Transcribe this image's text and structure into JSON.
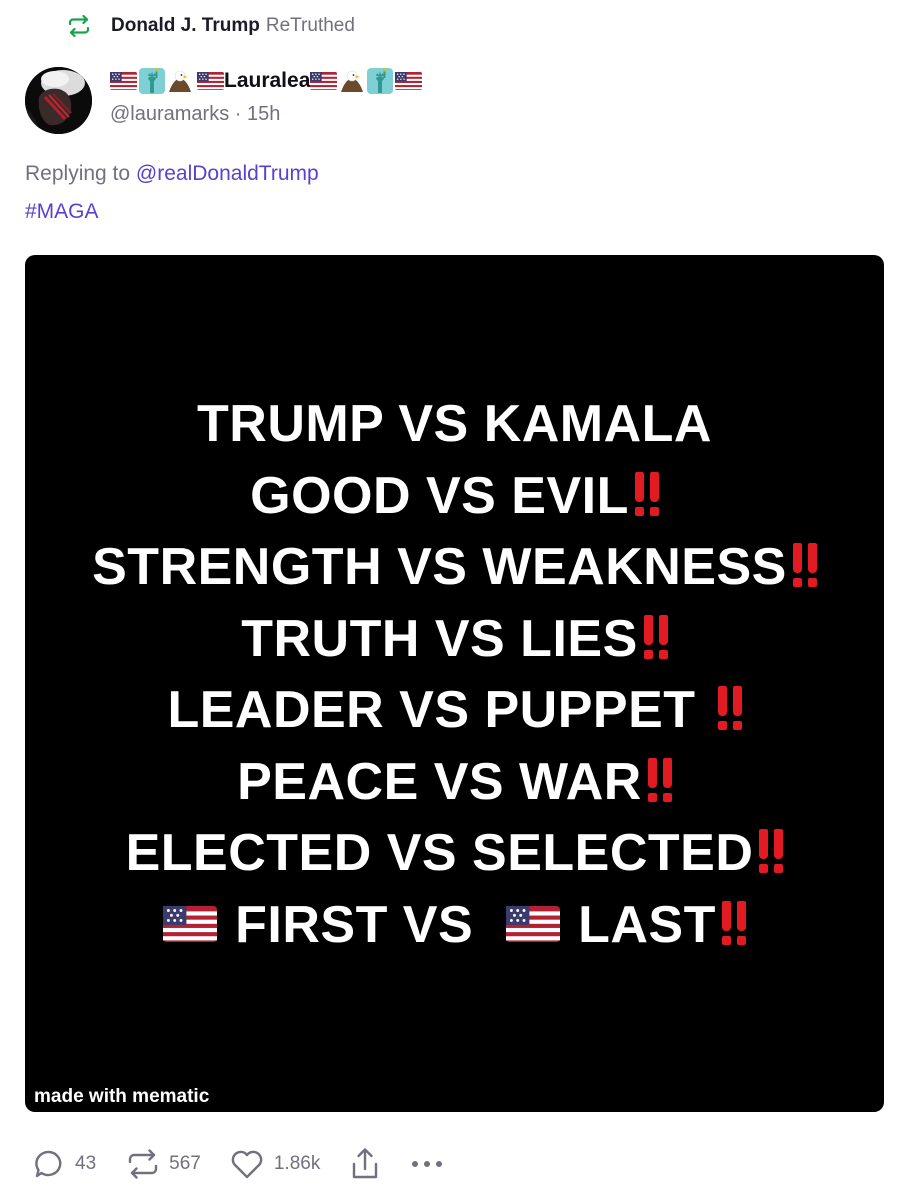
{
  "retruth": {
    "user": "Donald J. Trump",
    "label": "ReTruthed"
  },
  "post": {
    "display_name": "Lauralea",
    "handle": "@lauramarks",
    "separator": "·",
    "time": "15h",
    "replying_prefix": "Replying to",
    "replying_to": "@realDonaldTrump",
    "hashtag": "#MAGA"
  },
  "media": {
    "lines": [
      "TRUMP VS KAMALA",
      "GOOD VS EVIL",
      "STRENGTH VS WEAKNESS",
      "TRUTH VS LIES",
      "LEADER VS PUPPET",
      "PEACE VS WAR",
      "ELECTED VS SELECTED"
    ],
    "last_line_a": "FIRST VS",
    "last_line_b": "LAST",
    "watermark": "made with mematic"
  },
  "actions": {
    "replies": "43",
    "retruths": "567",
    "likes": "1.86k"
  },
  "colors": {
    "link": "#5b3fd0",
    "retruth_green": "#17a34a",
    "muted": "#72707e",
    "emphasis_red": "#e21b23"
  },
  "icons": [
    "retruth-icon",
    "us-flag-icon",
    "statue-of-liberty-icon",
    "eagle-icon",
    "reply-icon",
    "like-icon",
    "share-icon",
    "more-icon"
  ]
}
